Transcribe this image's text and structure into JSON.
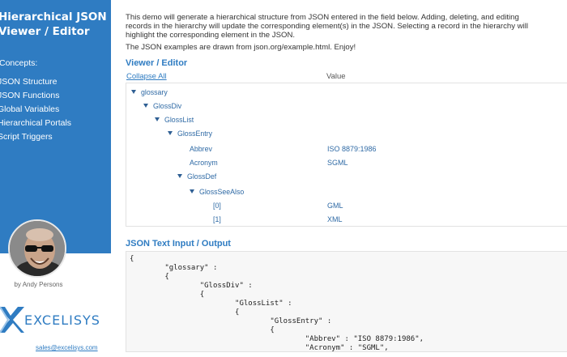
{
  "sidebar": {
    "title_line1": "Hierarchical JSON",
    "title_line2": "Viewer / Editor",
    "concepts_label": "Concepts:",
    "nav": [
      {
        "label": "JSON Structure"
      },
      {
        "label": "JSON Functions"
      },
      {
        "label": "Global Variables"
      },
      {
        "label": "Hierarchical Portals"
      },
      {
        "label": "Script Triggers"
      }
    ],
    "byline": "by Andy Persons",
    "logo_text": "EXCELISYS",
    "email": "sales@excelisys.com"
  },
  "main": {
    "intro_lines": [
      "This demo will generate a hierarchical structure from JSON entered in the field below. Adding, deleting, and editing",
      "records in the hierarchy will update the corresponding element(s) in the JSON. Selecting a record in the hierarchy will",
      "highlight the corresponding element in the JSON."
    ],
    "intro_examples": "The JSON examples are drawn from json.org/example.html. Enjoy!",
    "viewer_title": "Viewer / Editor",
    "collapse_all": "Collapse All",
    "value_header": "Value",
    "tree": [
      {
        "label": "glossary",
        "depth": 0,
        "expanded": true,
        "value": ""
      },
      {
        "label": "GlossDiv",
        "depth": 1,
        "expanded": true,
        "value": ""
      },
      {
        "label": "GlossList",
        "depth": 2,
        "expanded": true,
        "value": ""
      },
      {
        "label": "GlossEntry",
        "depth": 3,
        "expanded": true,
        "value": ""
      },
      {
        "label": "Abbrev",
        "depth": 4,
        "expanded": false,
        "value": "ISO 8879:1986"
      },
      {
        "label": "Acronym",
        "depth": 4,
        "expanded": false,
        "value": "SGML"
      },
      {
        "label": "GlossDef",
        "depth": 4,
        "expanded": true,
        "value": ""
      },
      {
        "label": "GlossSeeAlso",
        "depth": 5,
        "expanded": true,
        "value": ""
      },
      {
        "label": "[0]",
        "depth": 6,
        "expanded": false,
        "value": "GML"
      },
      {
        "label": "[1]",
        "depth": 6,
        "expanded": false,
        "value": "XML"
      }
    ],
    "json_title": "JSON Text Input / Output",
    "json_text": "{\n        \"glossary\" :\n        {\n                \"GlossDiv\" :\n                {\n                        \"GlossList\" :\n                        {\n                                \"GlossEntry\" :\n                                {\n                                        \"Abbrev\" : \"ISO 8879:1986\",\n                                        \"Acronym\" : \"SGML\",\n                                        \"GlossDef\" :"
  },
  "colors": {
    "brand_blue": "#2f7cc2",
    "link_blue": "#2f6aa5"
  },
  "icons": [
    "expand-triangle-icon",
    "excelisys-logo-icon"
  ]
}
